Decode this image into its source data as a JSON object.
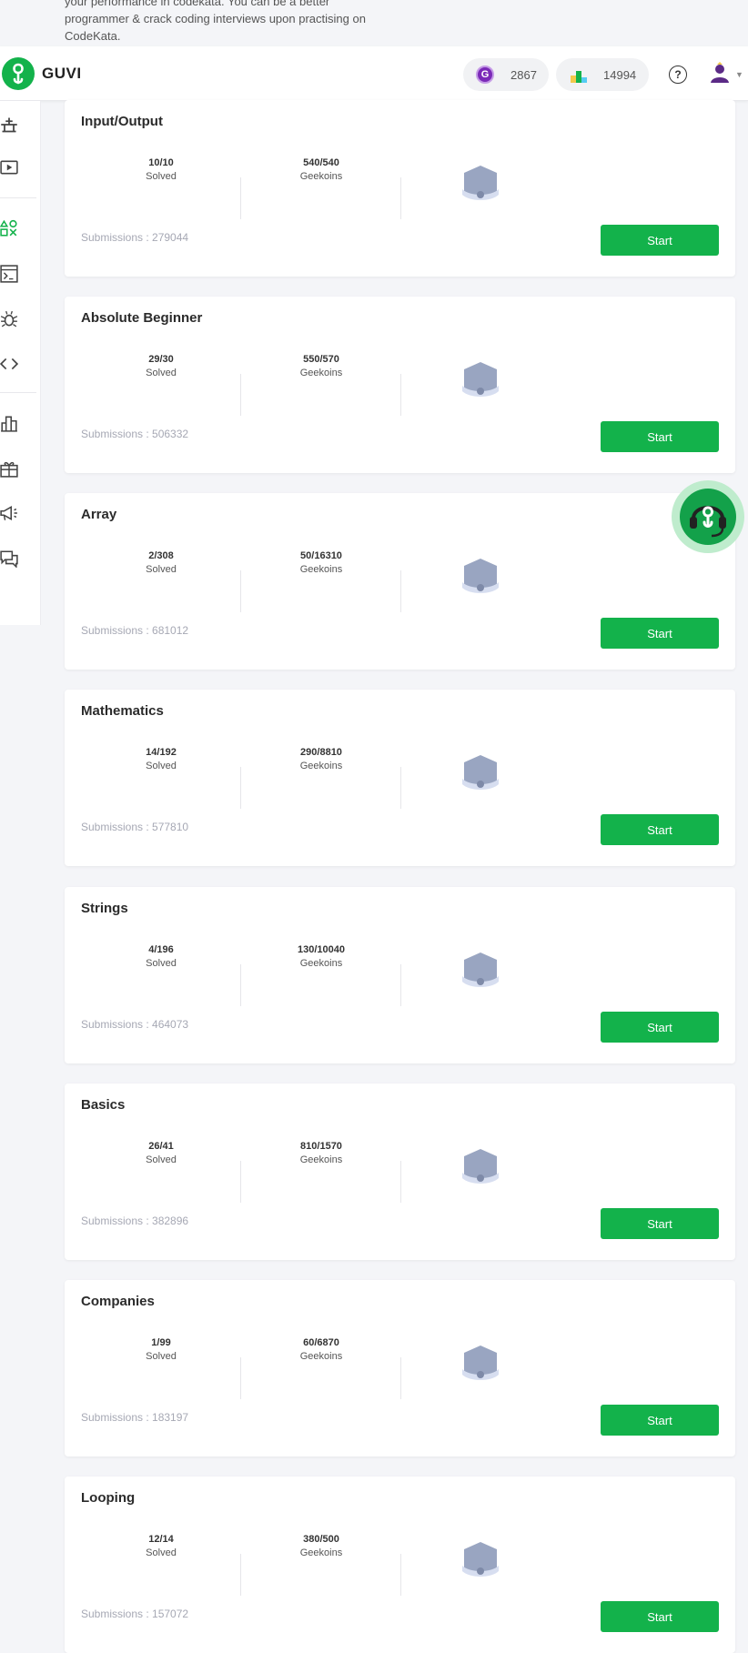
{
  "intro": {
    "line1": "your performance in codekata. You can be a better",
    "line2": "programmer & crack coding interviews upon practising on",
    "line3": "CodeKata."
  },
  "header": {
    "logo_text": "GUVI",
    "geekoins": "2867",
    "rank": "14994",
    "help_symbol": "?"
  },
  "cards": [
    {
      "title": "Input/Output",
      "solved": "10/10",
      "solved_label": "Solved",
      "geekoins": "540/540",
      "geekoins_label": "Geekoins",
      "submissions": "Submissions : 279044",
      "button": "Start"
    },
    {
      "title": "Absolute Beginner",
      "solved": "29/30",
      "solved_label": "Solved",
      "geekoins": "550/570",
      "geekoins_label": "Geekoins",
      "submissions": "Submissions : 506332",
      "button": "Start"
    },
    {
      "title": "Array",
      "solved": "2/308",
      "solved_label": "Solved",
      "geekoins": "50/16310",
      "geekoins_label": "Geekoins",
      "submissions": "Submissions : 681012",
      "button": "Start"
    },
    {
      "title": "Mathematics",
      "solved": "14/192",
      "solved_label": "Solved",
      "geekoins": "290/8810",
      "geekoins_label": "Geekoins",
      "submissions": "Submissions : 577810",
      "button": "Start"
    },
    {
      "title": "Strings",
      "solved": "4/196",
      "solved_label": "Solved",
      "geekoins": "130/10040",
      "geekoins_label": "Geekoins",
      "submissions": "Submissions : 464073",
      "button": "Start"
    },
    {
      "title": "Basics",
      "solved": "26/41",
      "solved_label": "Solved",
      "geekoins": "810/1570",
      "geekoins_label": "Geekoins",
      "submissions": "Submissions : 382896",
      "button": "Start"
    },
    {
      "title": "Companies",
      "solved": "1/99",
      "solved_label": "Solved",
      "geekoins": "60/6870",
      "geekoins_label": "Geekoins",
      "submissions": "Submissions : 183197",
      "button": "Start"
    },
    {
      "title": "Looping",
      "solved": "12/14",
      "solved_label": "Solved",
      "geekoins": "380/500",
      "geekoins_label": "Geekoins",
      "submissions": "Submissions : 157072",
      "button": "Start"
    }
  ],
  "colors": {
    "brand_green": "#13b24b",
    "badge_gray": "#99a5c1"
  }
}
